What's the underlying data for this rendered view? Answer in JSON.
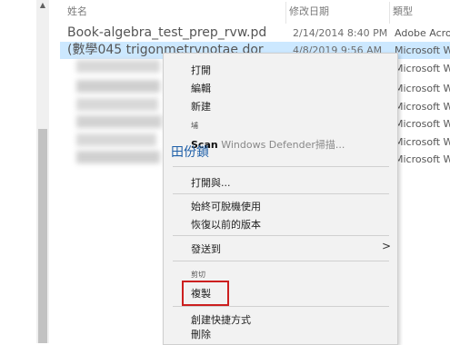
{
  "headers": {
    "name": "姓名",
    "date": "修改日期",
    "type": "類型"
  },
  "files": [
    {
      "name": "Book-algebra_test_prep_rvw.pd",
      "date": "2/14/2014 8:40 PM",
      "type": "Adobe Acrol"
    },
    {
      "name": "(數學045 trigonmetrvnotae dor",
      "date": "4/8/2019 9:56 AM",
      "type": "Microsoft W",
      "selected": true
    },
    {
      "name": "",
      "date": "",
      "type": "Microsoft W"
    },
    {
      "name": "",
      "date": "",
      "type": "Microsoft W"
    },
    {
      "name": "",
      "date": "",
      "type": "Microsoft W"
    },
    {
      "name": "",
      "date": "",
      "type": "Microsoft W"
    },
    {
      "name": "",
      "date": "",
      "type": "Microsoft W"
    },
    {
      "name": "",
      "date": "",
      "type": "Microsoft W"
    }
  ],
  "context_menu": {
    "open": "打開",
    "edit": "編輯",
    "new": "新建",
    "print_small": "埔",
    "scan_bold": "Scan",
    "scan_rest": " Windows Defender掃描...",
    "partial_overlay": "田份鎖",
    "open_with": "打開與...",
    "always_available": "始終可脫機使用",
    "restore_previous": "恢復以前的版本",
    "send_to": "發送到",
    "cut_small": "剪切",
    "copy": "複製",
    "create_shortcut": "創建快捷方式",
    "delete": "刪除"
  }
}
